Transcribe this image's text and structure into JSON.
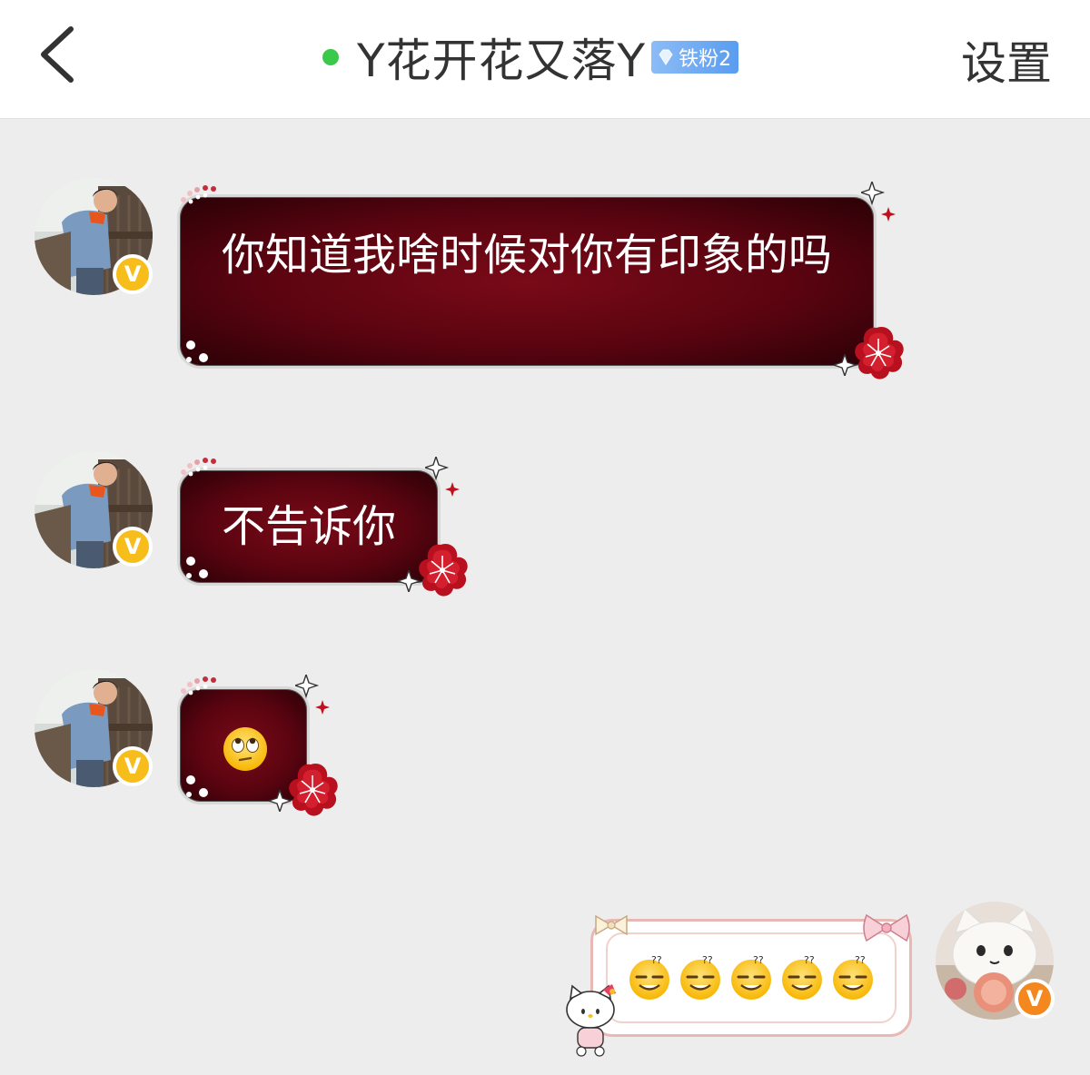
{
  "header": {
    "title": "Y花开花又落Y",
    "fan_badge": "铁粉2",
    "settings_label": "设置",
    "online_color": "#3cc84a"
  },
  "messages": [
    {
      "side": "left",
      "text": "你知道我啥时候对你有印象的吗"
    },
    {
      "side": "left",
      "text": "不告诉你"
    },
    {
      "side": "left",
      "emoji": "eye-roll-emoji"
    },
    {
      "side": "right",
      "emojis": [
        "squint-question-emoji",
        "squint-question-emoji",
        "squint-question-emoji",
        "squint-question-emoji",
        "squint-question-emoji"
      ]
    }
  ],
  "colors": {
    "bubble_dark": "#5a0410",
    "badge_yellow": "#f7bd1a",
    "badge_orange": "#f5871f"
  },
  "badges": {
    "verified": "V"
  }
}
